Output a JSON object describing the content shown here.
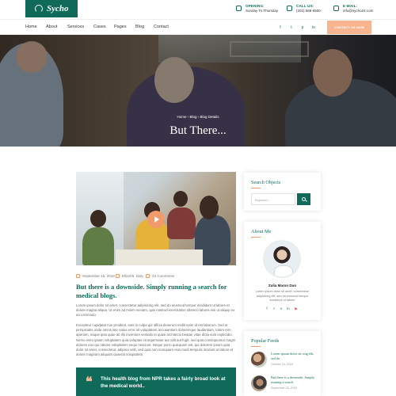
{
  "brand": {
    "name": "Sycho",
    "accent": "#0f6a59",
    "secondary": "#f7b48f"
  },
  "topbar": {
    "opening": {
      "label": "OPENING:",
      "value": "Sunday To Thursday"
    },
    "call": {
      "label": "CALL US:",
      "value": "(202) 588-6500"
    },
    "email": {
      "label": "E-MAIL:",
      "value": "info@sycho24.com"
    }
  },
  "nav": {
    "items": [
      "Home",
      "About",
      "Services",
      "Cases",
      "Pages",
      "Blog",
      "Contact"
    ],
    "social_icons": [
      "facebook-icon",
      "twitter-icon",
      "pinterest-icon",
      "instagram-icon"
    ],
    "social_glyphs": [
      "f",
      "t",
      "p",
      "in"
    ],
    "contact_button": "CONTACT US NOW"
  },
  "hero": {
    "breadcrumb": [
      "Home",
      "Blog",
      "Blog Details"
    ],
    "title": "But There..."
  },
  "post": {
    "date": "September 16, 2018",
    "author": "Elliott B. Daly",
    "comments": "23 Comments",
    "title": "But there is a downside. Simply running a search for medical blogs.",
    "para1": "Lorem ipsum dolor sit amet, consectetur adipisicing elit, sed do eiusmod tempor incididunt ut labore et dolore magna aliqua. Ut enim ad minim veniam, quis nostrud exercitation ullamco laboris nisi ut aliquip ex ea commodo.",
    "para2": "Excepteur cupidatat non proident, sunt in culpa qui officia deserunt mollit anim id est laborum. Sed ut perspiciatis unde omnis iste natus error sit voluptatem accusantium doloremque laudantium, totam rem aperiam, eaque ipsa quae ab illo inventore veritatis et quasi architecto beatae vitae dicta sunt explicabo. Nemo enim ipsam voluptatem quia voluptas sit aspernatur aut odit aut fugit, sed quia consequuntur magni dolores eos qui ratione voluptatem sequi nesciunt. Neque porro quisquam est, qui dolorem ipsum quia dolor sit amet, consectetur, adipisci velit, sed quia non numquam eius modi tempora incidunt ut labore et dolore magnam aliquam quaerat voluptatem.",
    "quote": "This health blog from NPR takes a fairly broad look at the medical world.."
  },
  "sidebar": {
    "search": {
      "title": "Search Objects",
      "placeholder": "Keyword..."
    },
    "about": {
      "title": "About Me",
      "name": "Zulia Maron Duo",
      "text": "Lorem ipsum dolor sit amet, consectetur adipisicing elit, sed do eiusmod tempor incididunt ut labore",
      "social_icons": [
        "facebook-icon",
        "twitter-icon",
        "vimeo-icon",
        "instagram-icon",
        "youtube-icon"
      ],
      "social_glyphs": [
        "f",
        "t",
        "v",
        "in",
        "▶"
      ]
    },
    "feeds": {
      "title": "Popular Feeds",
      "items": [
        {
          "title": "Lorem ipsum dolor sit cing elit, sed do.",
          "date": "October 15, 2018"
        },
        {
          "title": "But there is a downside. Simply running a search",
          "date": "September 25, 2018"
        }
      ]
    }
  }
}
